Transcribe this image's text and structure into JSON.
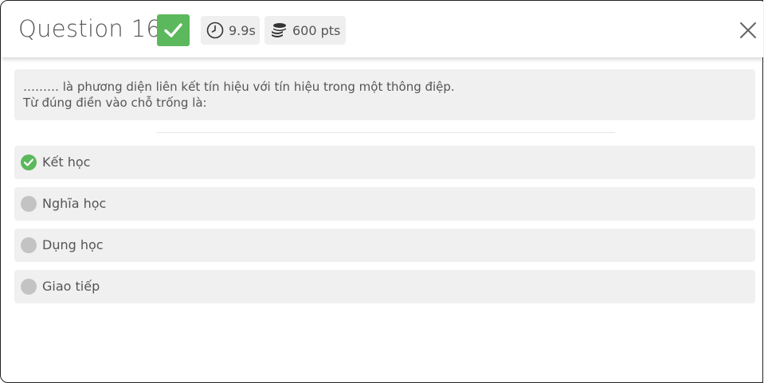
{
  "header": {
    "title": "Question 16",
    "status_icon": "check-icon",
    "time_icon": "clock-icon",
    "time": "9.9s",
    "points_icon": "coins-icon",
    "points": "600 pts",
    "close_icon": "close-icon"
  },
  "question": {
    "line1": "……… là phương diện liên kết tín hiệu với tín hiệu trong một thông điệp.",
    "line2": "Từ đúng điền vào chỗ trống là:"
  },
  "answers": [
    {
      "label": "Kết học",
      "state": "correct"
    },
    {
      "label": "Nghĩa học",
      "state": "neutral"
    },
    {
      "label": "Dụng học",
      "state": "neutral"
    },
    {
      "label": "Giao tiếp",
      "state": "neutral"
    }
  ],
  "colors": {
    "correct": "#5cb85c",
    "neutral": "#c3c3c3",
    "panel": "#f0f0f0"
  }
}
